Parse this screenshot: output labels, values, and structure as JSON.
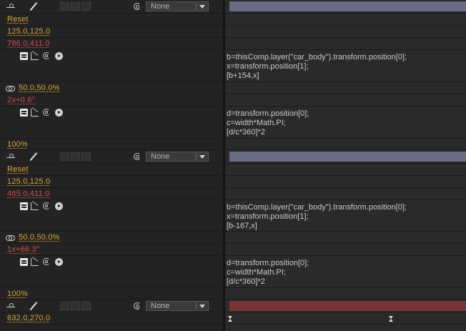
{
  "colors": {
    "gold": "#d6a53a",
    "red": "#cf4e4e",
    "layer_bar_1": "#6a6c85",
    "layer_bar_2": "#6a6c85",
    "layer_bar_3": "#7a3438"
  },
  "layers": [
    {
      "parent_dropdown": "None",
      "anchor_reset": "Reset",
      "anchor_value": "125.0,125.0",
      "position_value": "786.0,411.0",
      "position_expression": [
        "b=thisComp.layer(\"car_body\").transform.position[0];",
        "x=transform.position[1];",
        "[b+154,x]"
      ],
      "scale_value": "50.0,50.0%",
      "rotation_value": "2x+0.6°",
      "rotation_expression": [
        "d=transform.position[0];",
        "c=width*Math.PI;",
        "[d/c*360]*2"
      ],
      "opacity_value": "100%"
    },
    {
      "parent_dropdown": "None",
      "anchor_reset": "Reset",
      "anchor_value": "125.0,125.0",
      "position_value": "465.0,411.0",
      "position_expression": [
        "b=thisComp.layer(\"car_body\").transform.position[0];",
        "x=transform.position[1];",
        "[b-167,x]"
      ],
      "scale_value": "50.0,50.0%",
      "rotation_value": "1x+66.3°",
      "rotation_expression": [
        "d=transform.position[0];",
        "c=width*Math.PI;",
        "[d/c*360]*2"
      ],
      "opacity_value": "100%"
    },
    {
      "parent_dropdown": "None",
      "position_value": "632.0,270.0"
    }
  ],
  "icons": [
    "anchor-icon",
    "pen-icon",
    "spiral-icon",
    "chain-link-icon",
    "expression-enable-icon",
    "graph-icon",
    "pick-whip-icon",
    "language-menu-icon",
    "keyframe-icon"
  ]
}
